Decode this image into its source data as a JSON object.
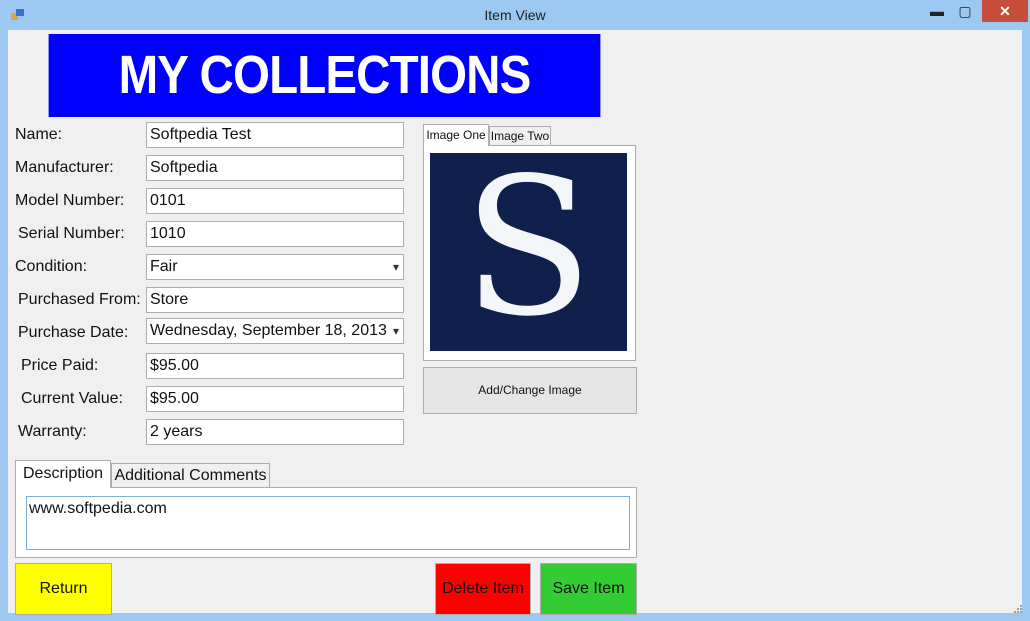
{
  "window": {
    "title": "Item View",
    "minimize": "▬",
    "maximize": "▢",
    "close": "✕"
  },
  "banner": {
    "text": "MY COLLECTIONS",
    "background": "#0000ff"
  },
  "fields": {
    "name": {
      "label": "Name:",
      "value": "Softpedia Test"
    },
    "manufacturer": {
      "label": "Manufacturer:",
      "value": "Softpedia"
    },
    "model_number": {
      "label": "Model Number:",
      "value": "0101"
    },
    "serial_number": {
      "label": "Serial Number:",
      "value": "1010"
    },
    "condition": {
      "label": "Condition:",
      "value": "Fair"
    },
    "purchased_from": {
      "label": "Purchased From:",
      "value": "Store"
    },
    "purchase_date": {
      "label": "Purchase Date:",
      "value": "Wednesday, September 18, 2013"
    },
    "price_paid": {
      "label": "Price Paid:",
      "value": "$95.00"
    },
    "current_value": {
      "label": "Current Value:",
      "value": "$95.00"
    },
    "warranty": {
      "label": "Warranty:",
      "value": "2 years"
    }
  },
  "image_tabs": [
    {
      "label": "Image One"
    },
    {
      "label": "Image Two"
    }
  ],
  "image": {
    "logo_letter": "S",
    "logo_background": "#10204c"
  },
  "add_image_button": "Add/Change Image",
  "text_tabs": [
    {
      "label": "Description"
    },
    {
      "label": "Additional Comments"
    }
  ],
  "description_text": "www.softpedia.com",
  "buttons": {
    "return": {
      "label": "Return",
      "color": "#ffff00"
    },
    "delete": {
      "label": "Delete Item",
      "color": "#ff0000"
    },
    "save": {
      "label": "Save Item",
      "color": "#33cc33"
    }
  }
}
